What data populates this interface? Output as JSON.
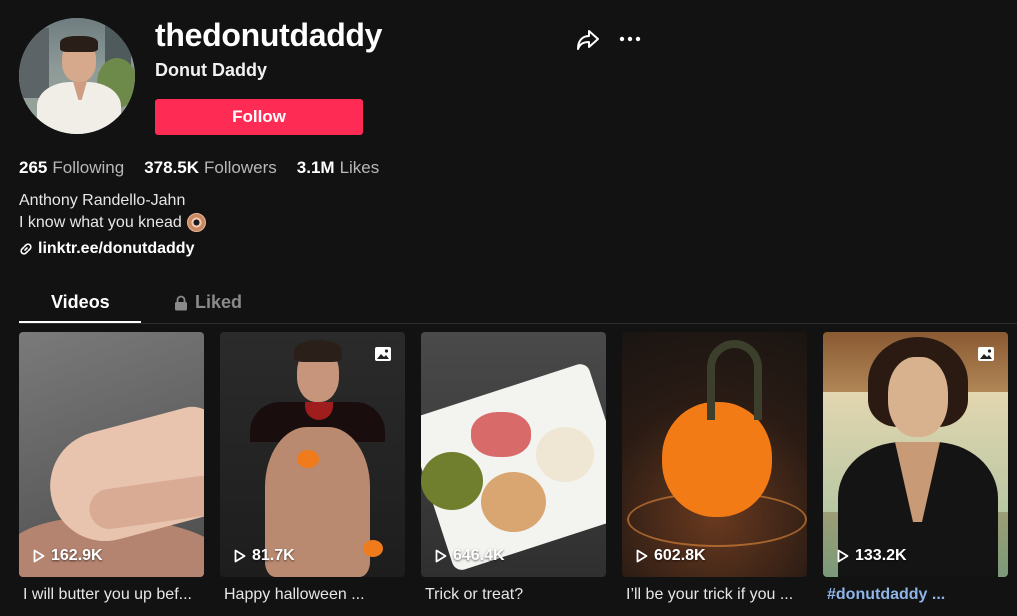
{
  "profile": {
    "username": "thedonutdaddy",
    "nickname": "Donut Daddy",
    "follow_label": "Follow"
  },
  "stats": [
    {
      "count": "265",
      "label": "Following"
    },
    {
      "count": "378.5K",
      "label": "Followers"
    },
    {
      "count": "3.1M",
      "label": "Likes"
    }
  ],
  "bio": {
    "name": "Anthony Randello-Jahn",
    "text": "I know what you knead",
    "emoji": "donut-emoji",
    "link": "linktr.ee/donutdaddy"
  },
  "tabs": {
    "videos": "Videos",
    "liked": "Liked"
  },
  "videos": [
    {
      "views": "162.9K",
      "caption": "I will butter you up bef...",
      "is_photo": false
    },
    {
      "views": "81.7K",
      "caption": "Happy halloween ...",
      "is_photo": true
    },
    {
      "views": "646.4K",
      "caption": "Trick or treat?",
      "is_photo": false
    },
    {
      "views": "602.8K",
      "caption": "I’ll be your trick if you ...",
      "is_photo": false
    },
    {
      "views": "133.2K",
      "caption": "#donutdaddy ...",
      "is_photo": true
    }
  ],
  "colors": {
    "background": "#121212",
    "follow_button": "#fe2c55",
    "hashtag": "#8fb4e8"
  }
}
